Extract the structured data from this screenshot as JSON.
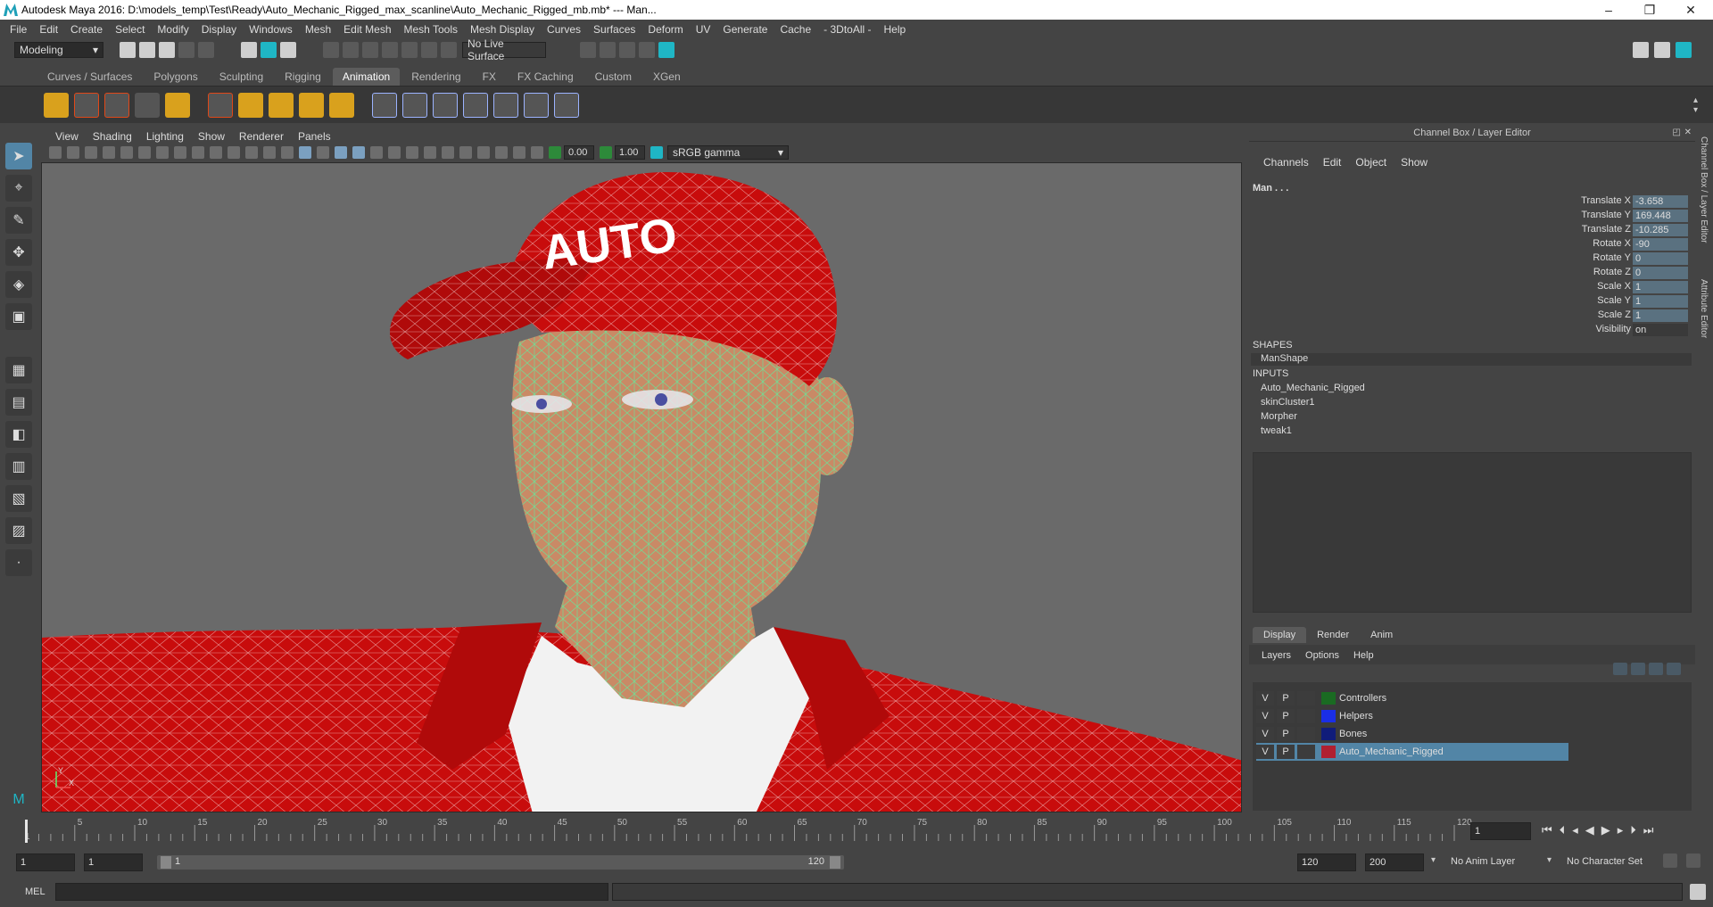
{
  "window": {
    "title": "Autodesk Maya 2016: D:\\models_temp\\Test\\Ready\\Auto_Mechanic_Rigged_max_scanline\\Auto_Mechanic_Rigged_mb.mb*   ---   Man...",
    "minimize": "–",
    "maximize": "❐",
    "close": "✕"
  },
  "menubar": [
    "File",
    "Edit",
    "Create",
    "Select",
    "Modify",
    "Display",
    "Windows",
    "Mesh",
    "Edit Mesh",
    "Mesh Tools",
    "Mesh Display",
    "Curves",
    "Surfaces",
    "Deform",
    "UV",
    "Generate",
    "Cache",
    "- 3DtoAll -",
    "Help"
  ],
  "statusline": {
    "mode": "Modeling",
    "live_surface": "No Live Surface"
  },
  "shelf_tabs": [
    "Curves / Surfaces",
    "Polygons",
    "Sculpting",
    "Rigging",
    "Animation",
    "Rendering",
    "FX",
    "FX Caching",
    "Custom",
    "XGen"
  ],
  "shelf_active": "Animation",
  "panel_menu": [
    "View",
    "Shading",
    "Lighting",
    "Show",
    "Renderer",
    "Panels"
  ],
  "panel_toolbar": {
    "exposure": "0.00",
    "gamma": "1.00",
    "color_space": "sRGB gamma"
  },
  "viewport": {
    "cap_text": "AUTO",
    "axis_y": "Y",
    "axis_x": "X"
  },
  "channel_box": {
    "header": "Channel Box / Layer Editor",
    "menus": [
      "Channels",
      "Edit",
      "Object",
      "Show"
    ],
    "object": "Man . . .",
    "channels": [
      {
        "label": "Translate X",
        "value": "-3.658"
      },
      {
        "label": "Translate Y",
        "value": "169.448"
      },
      {
        "label": "Translate Z",
        "value": "-10.285"
      },
      {
        "label": "Rotate X",
        "value": "-90"
      },
      {
        "label": "Rotate Y",
        "value": "0"
      },
      {
        "label": "Rotate Z",
        "value": "0"
      },
      {
        "label": "Scale X",
        "value": "1"
      },
      {
        "label": "Scale Y",
        "value": "1"
      },
      {
        "label": "Scale Z",
        "value": "1"
      },
      {
        "label": "Visibility",
        "value": "on"
      }
    ],
    "shapes_label": "SHAPES",
    "shapes": [
      "ManShape"
    ],
    "inputs_label": "INPUTS",
    "inputs": [
      "Auto_Mechanic_Rigged",
      "skinCluster1",
      "Morpher",
      "tweak1"
    ],
    "side_tabs": [
      "Channel Box / Layer Editor",
      "Attribute Editor"
    ]
  },
  "layer_editor": {
    "tabs": [
      "Display",
      "Render",
      "Anim"
    ],
    "menus": [
      "Layers",
      "Options",
      "Help"
    ],
    "layers": [
      {
        "v": "V",
        "p": "P",
        "color": "#1a6b22",
        "name": "Controllers"
      },
      {
        "v": "V",
        "p": "P",
        "color": "#1a2ee6",
        "name": "Helpers"
      },
      {
        "v": "V",
        "p": "P",
        "color": "#101c7a",
        "name": "Bones"
      },
      {
        "v": "V",
        "p": "P",
        "color": "#b02030",
        "name": "Auto_Mechanic_Rigged"
      }
    ]
  },
  "time_slider": {
    "ticks": [
      "1",
      "5",
      "10",
      "15",
      "20",
      "25",
      "30",
      "35",
      "40",
      "45",
      "50",
      "55",
      "60",
      "65",
      "70",
      "75",
      "80",
      "85",
      "90",
      "95",
      "100",
      "105",
      "110",
      "115",
      "120"
    ],
    "current_frame": "1"
  },
  "range_slider": {
    "start": "1",
    "playback_start": "1",
    "range_start_label": "1",
    "range_end_label": "120",
    "playback_end": "120",
    "end": "200",
    "anim_layer": "No Anim Layer",
    "character_set": "No Character Set"
  },
  "command_line": {
    "label": "MEL"
  }
}
